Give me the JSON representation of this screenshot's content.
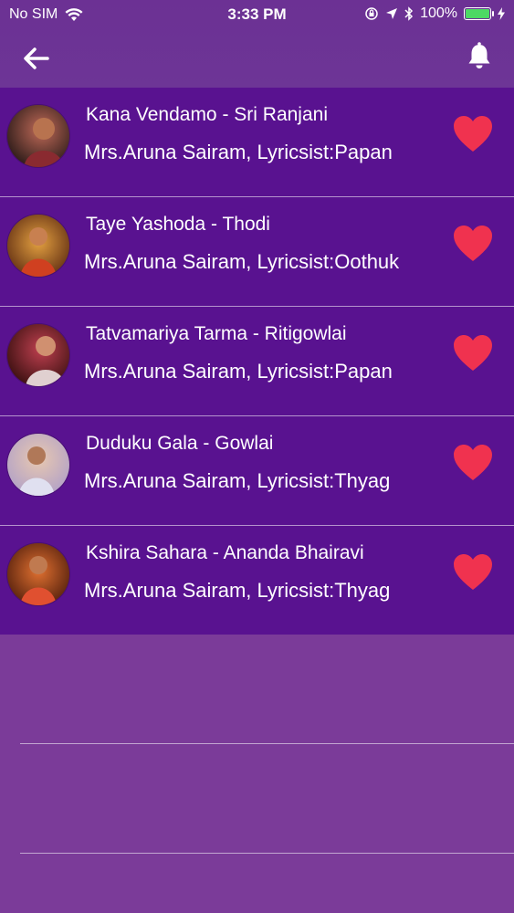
{
  "status_bar": {
    "carrier": "No SIM",
    "time": "3:33 PM",
    "battery": "100%"
  },
  "nav": {
    "back_icon": "arrow-left-icon",
    "bell_icon": "bell-icon"
  },
  "songs": [
    {
      "title": "Kana Vendamo - Sri Ranjani",
      "subtitle": "Mrs.Aruna Sairam, Lyricsist:Papan",
      "favorite": true,
      "avatar_colors": [
        "#2a1a18",
        "#c06a58"
      ]
    },
    {
      "title": "Taye Yashoda - Thodi",
      "subtitle": "Mrs.Aruna Sairam, Lyricsist:Oothuk",
      "favorite": true,
      "avatar_colors": [
        "#5a2810",
        "#e3a040"
      ]
    },
    {
      "title": "Tatvamariya Tarma - Ritigowlai",
      "subtitle": "Mrs.Aruna Sairam, Lyricsist:Papan",
      "favorite": true,
      "avatar_colors": [
        "#3a1010",
        "#c04050"
      ]
    },
    {
      "title": "Duduku Gala - Gowlai",
      "subtitle": "Mrs.Aruna Sairam, Lyricsist:Thyag",
      "favorite": true,
      "avatar_colors": [
        "#b0a0c8",
        "#e8c8b0"
      ]
    },
    {
      "title": "Kshira Sahara - Ananda Bhairavi",
      "subtitle": "Mrs.Aruna Sairam, Lyricsist:Thyag",
      "favorite": true,
      "avatar_colors": [
        "#4a1a0a",
        "#e07030"
      ]
    }
  ],
  "colors": {
    "header": "#6c3194",
    "list_bg": "#591290",
    "page_bg": "#7a3a98",
    "heart": "#f0324f"
  }
}
